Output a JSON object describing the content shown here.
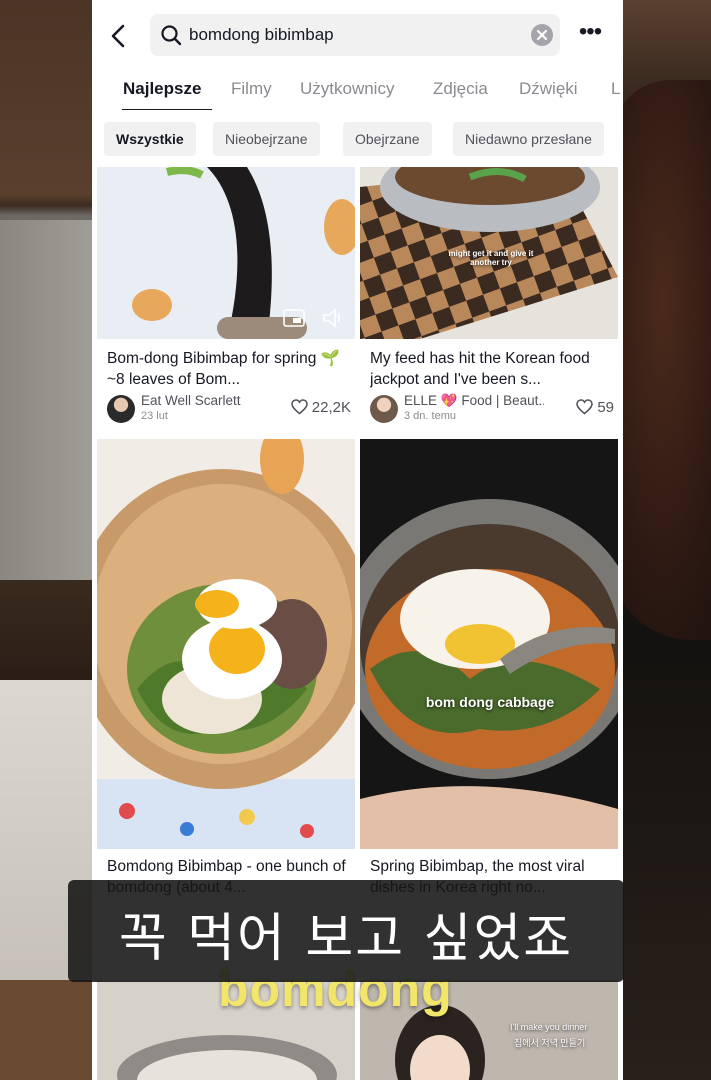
{
  "search": {
    "query": "bomdong bibimbap"
  },
  "tabs": [
    {
      "label": "Najlepsze",
      "active": true
    },
    {
      "label": "Filmy"
    },
    {
      "label": "Użytkownicy"
    },
    {
      "label": "Zdjęcia"
    },
    {
      "label": "Dźwięki"
    },
    {
      "label": "L"
    }
  ],
  "filters": [
    {
      "label": "Wszystkie",
      "active": true
    },
    {
      "label": "Nieobejrzane"
    },
    {
      "label": "Obejrzane"
    },
    {
      "label": "Niedawno przesłane"
    }
  ],
  "cards": [
    {
      "title": "Bom-dong Bibimbap for spring 🌱 ~8 leaves of Bom...",
      "author": "Eat Well Scarlett",
      "date": "23 lut",
      "likes": "22,2K"
    },
    {
      "title": "My feed has hit the Korean food jackpot and I've been s...",
      "overlay": "might get it and give it another try",
      "author": "ELLE 💖 Food | Beaut...",
      "date": "3 dn. temu",
      "likes": "59"
    },
    {
      "title": "Bomdong Bibimbap - one bunch of bomdong (about 4..."
    },
    {
      "title": "Spring Bibimbap, the most viral dishes in Korea right no...",
      "overlay": "bom dong cabbage"
    },
    {
      "overlay": "I'll make you dinner",
      "overlay_ko": "집에서 저녁 만들기"
    }
  ],
  "caption": {
    "text": "꼭 먹어 보고 싶었죠",
    "bottom_word": "bomdong"
  },
  "colors": {
    "text_primary": "#161823",
    "text_secondary": "#8a8b91",
    "chip_bg": "#f1f1f2",
    "caption_yellow": "#f2e66a"
  }
}
